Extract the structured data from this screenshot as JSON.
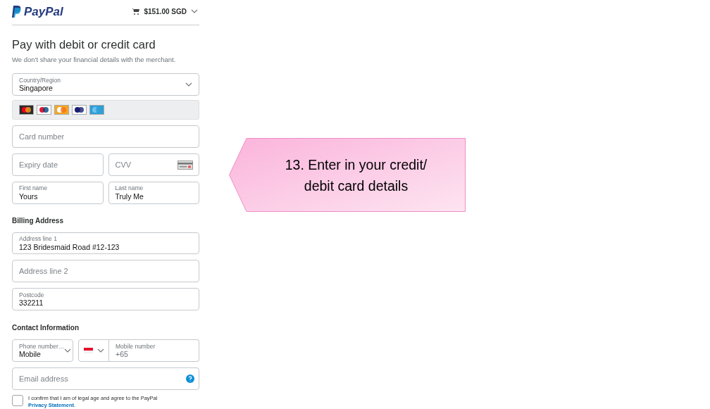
{
  "header": {
    "logo": "PayPal",
    "cart_total": "$151.00 SGD"
  },
  "title": "Pay with debit or credit card",
  "subtitle": "We don't share your financial details with the merchant.",
  "country": {
    "label": "Country/Region",
    "value": "Singapore"
  },
  "card_number": {
    "placeholder": "Card number"
  },
  "expiry": {
    "placeholder": "Expiry date"
  },
  "cvv": {
    "placeholder": "CVV"
  },
  "first_name": {
    "label": "First name",
    "value": "Yours"
  },
  "last_name": {
    "label": "Last name",
    "value": "Truly Me"
  },
  "billing_heading": "Billing Address",
  "address_fields": [
    {
      "label": "Address line 1",
      "value": "123 Bridesmaid Road #12-123"
    },
    {
      "placeholder": "Address line 2"
    },
    {
      "label": "Postcode",
      "value": "332211"
    }
  ],
  "contact_heading": "Contact Information",
  "phone_type": {
    "label": "Phone number…",
    "value": "Mobile"
  },
  "mobile": {
    "label": "Mobile number",
    "value": "+65"
  },
  "email": {
    "placeholder": "Email address"
  },
  "consent": {
    "checked": false,
    "text": "I confirm that I am of legal age and agree to the PayPal ",
    "link": "Privacy Statement",
    "after": "."
  },
  "callout": "13. Enter in your credit/ debit card details"
}
